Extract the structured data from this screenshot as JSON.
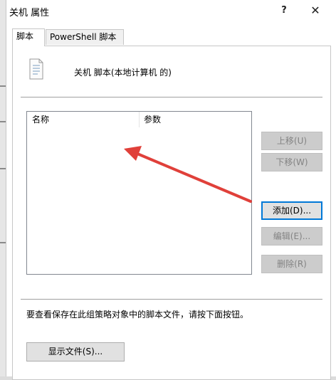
{
  "window": {
    "title": "关机 属性",
    "help_glyph": "?",
    "close_glyph": "✕"
  },
  "tabs": [
    {
      "label": "脚本",
      "active": true
    },
    {
      "label": "PowerShell 脚本",
      "active": false
    }
  ],
  "header": {
    "text": "关机 脚本(本地计算机 的)",
    "icon": "script-document-icon"
  },
  "list": {
    "columns": [
      "名称",
      "参数"
    ],
    "rows": []
  },
  "buttons": {
    "up": "上移(U)",
    "down": "下移(W)",
    "add": "添加(D)...",
    "edit": "编辑(E)...",
    "remove": "删除(R)"
  },
  "footer": {
    "info": "要查看保存在此组策略对象中的脚本文件，请按下面按钮。",
    "show_files": "显示文件(S)..."
  },
  "annotation": {
    "icon": "red-arrow-annotation",
    "color": "#e0403a"
  }
}
